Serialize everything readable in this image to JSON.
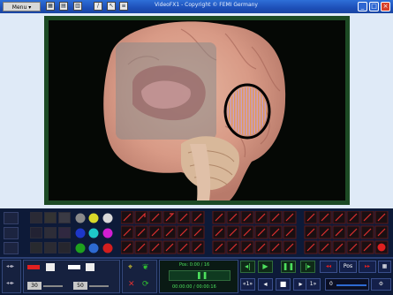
{
  "titlebar": {
    "menu_label": "Menu",
    "title": "VideoFX1 - Copyright © FEMI Germany",
    "icons": [
      "film-icon",
      "save-icon",
      "print-icon",
      "slash-icon",
      "cursor-icon",
      "list-icon"
    ]
  },
  "palette": {
    "colors": [
      "#8a8a8a",
      "#d9d92a",
      "#d9d9d9",
      "#1d37c8",
      "#1ec8c8",
      "#d21ed2",
      "#1ea01e",
      "#2d6ad2",
      "#d21e1e"
    ]
  },
  "controls": {
    "pen_value": "30",
    "pen_value2": "50",
    "pos_label": "Pos: 0:00 / 16",
    "time_readout": "00:00:00 / 00:00:16",
    "frame_value": "0",
    "pos_button": "Pos",
    "slider_label_lo": "«1»",
    "speed_label": "1»"
  },
  "colors": {
    "frame_green": "#1c4a24",
    "toolbar_bg": "#0d1a38",
    "highlight_red": "#e02020"
  }
}
